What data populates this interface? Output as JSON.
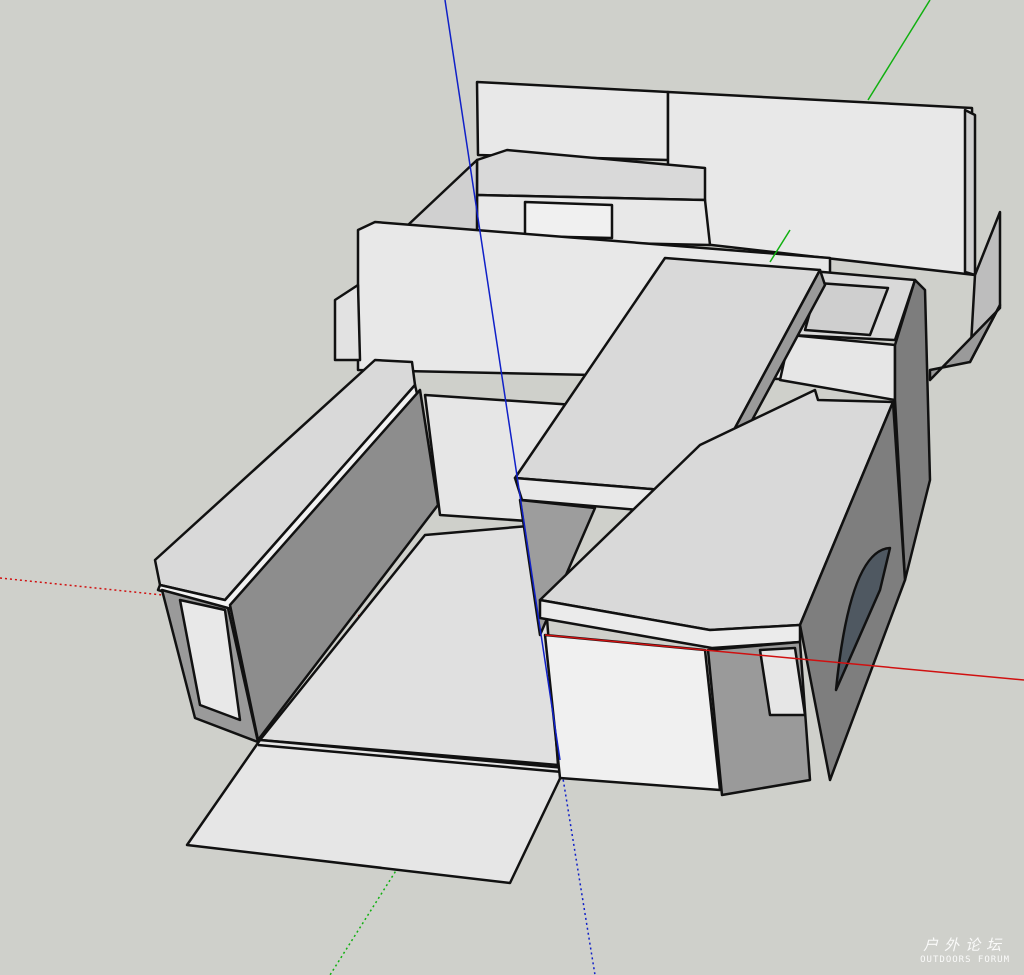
{
  "viewport": {
    "background": "#cfd0cb",
    "axis_colors": {
      "red": "#d01010",
      "green": "#10b010",
      "blue": "#1020c8"
    },
    "face_colors": {
      "light": "#e6e6e6",
      "top": "#d9d9d9",
      "shade": "#9a9a9a",
      "dark": "#7d7d7d",
      "wheel": "#4f5861"
    }
  },
  "watermark": {
    "line1": "户外论坛",
    "line2": "OUTDOORS FORUM",
    "color": "#ffffff"
  }
}
